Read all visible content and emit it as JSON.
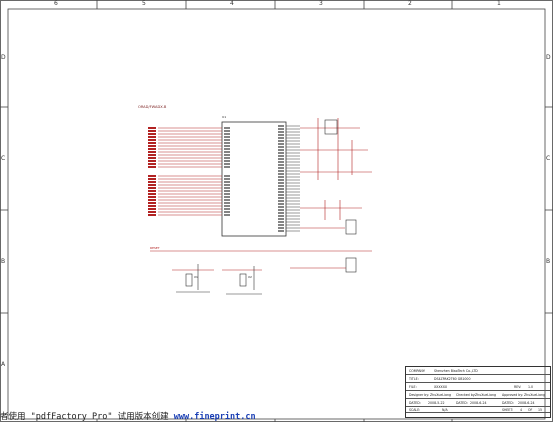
{
  "frame": {
    "top_zones": [
      "6",
      "5",
      "4",
      "3",
      "2",
      "1"
    ],
    "side_zones": [
      "D",
      "C",
      "B",
      "A"
    ]
  },
  "schematic": {
    "block_title": "ORAD/FWADX.B",
    "mcu_ref": "U1",
    "x1_label": "X1",
    "x2_label": "X2",
    "reset_label": "RESET",
    "colors": {
      "net_label": "#b22222",
      "wire": "#b22222",
      "body": "#333333"
    }
  },
  "title_block": {
    "company_label": "COMPANY:",
    "company_value": "Shenzhen BiaoTech Co.,LTD",
    "title_label": "TITLE:",
    "title_value": "DS4ZPAK2T60 GB1000",
    "file_label": "FILE:",
    "file_value": "XXXXXX",
    "rev_label": "REV:",
    "rev_value": "1.0",
    "designer_label": "Designer by:",
    "designer_value": "ZhuXueLiang",
    "checked_label": "Checked by:",
    "checked_value": "ZhuXueLiang",
    "approved_label": "Approved by:",
    "approved_value": "ZhuXueLiang",
    "dated1_label": "DATED:",
    "dated1_value": "2008-5-22",
    "dated2_label": "DATED:",
    "dated2_value": "2008-6-24",
    "dated3_label": "DATED:",
    "dated3_value": "2008-6-24",
    "scale_label": "SCALE:",
    "scale_value": "N/A",
    "sheet_label": "SHEET:",
    "sheet_value": "4",
    "of_label": "OF",
    "of_value": "15"
  },
  "watermark": {
    "text": "者使用 \"pdfFactory Pro\" 试用版本创建 ",
    "url": "www.fineprint.cn"
  }
}
